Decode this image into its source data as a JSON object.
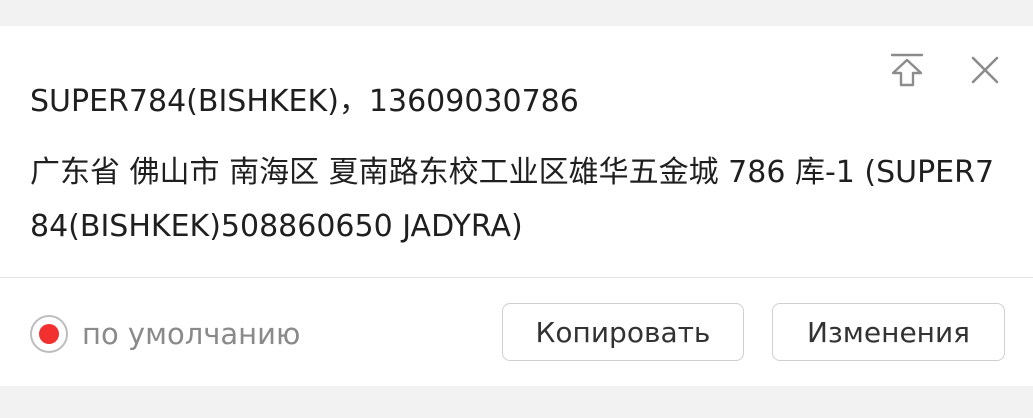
{
  "address_card": {
    "contact_line": "SUPER784(BISHKEK)，13609030786",
    "address_text": "广东省 佛山市 南海区 夏南路东校工业区雄华五金城 786 库-1 (SUPER784(BISHKEK)508860650 JADYRA)",
    "default_label": "по умолчанию",
    "default_checked": true,
    "copy_button_label": "Копировать",
    "edit_button_label": "Изменения",
    "icons": {
      "pin_top": "pin-to-top-icon",
      "close": "close-icon"
    }
  },
  "colors": {
    "accent_red": "#f23030",
    "muted_text": "#8a8a8a",
    "border": "#cfcfcf"
  }
}
